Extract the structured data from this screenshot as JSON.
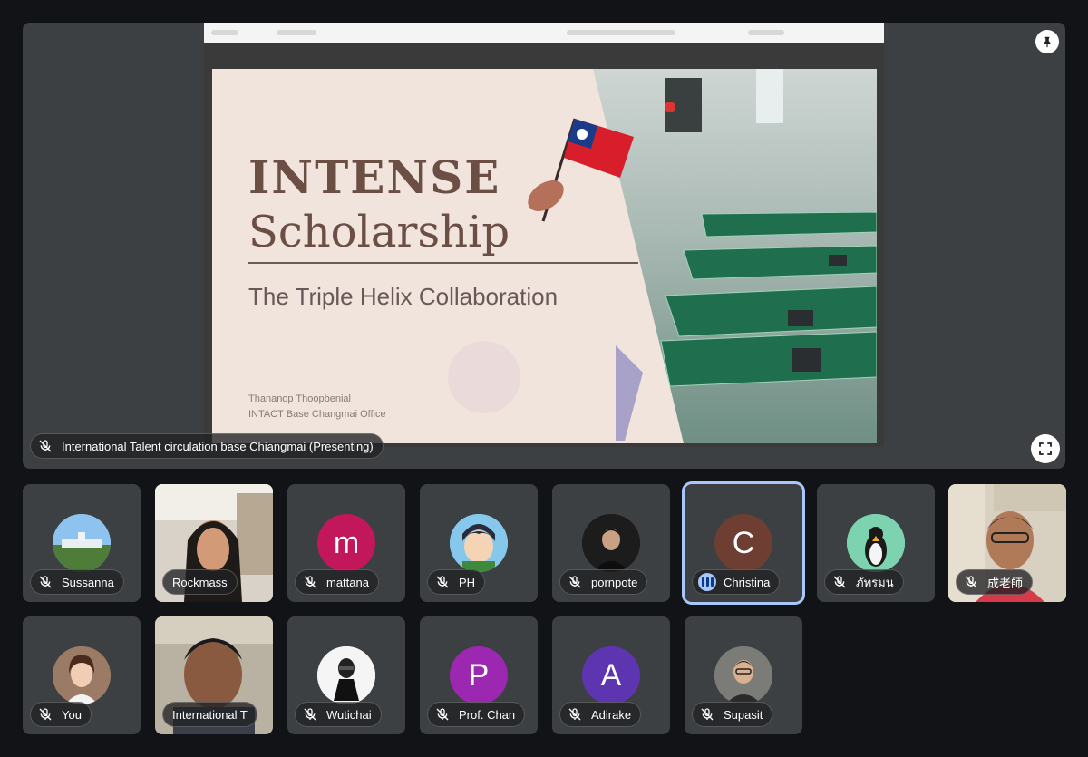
{
  "slide": {
    "title_line1": "INTENSE",
    "title_line2": "Scholarship",
    "subtitle": "The Triple Helix Collaboration",
    "presenter_name": "Thananop Thoopbenial",
    "presenter_office": "INTACT Base Changmai Office"
  },
  "presenter_badge": "International Talent circulation base Chiangmai (Presenting)",
  "icons": {
    "pin": "pin-icon",
    "fullscreen": "fullscreen-icon",
    "mic_off": "mic-off-icon",
    "speaking": "audio-level-icon"
  },
  "colors": {
    "background": "#121316",
    "tile": "#3c4043",
    "active_border": "#a8c7fa",
    "speaking_badge": "#a8c7fa"
  },
  "participants": [
    {
      "name": "Sussanna"
    },
    {
      "name": "Rockmass"
    },
    {
      "name": "mattana",
      "initial": "m",
      "color": "#c2185b"
    },
    {
      "name": "PH"
    },
    {
      "name": "pornpote"
    },
    {
      "name": "Christina",
      "initial": "C",
      "color": "#6d3e31"
    },
    {
      "name": "ภัทรมน"
    },
    {
      "name": "成老師"
    },
    {
      "name": "You"
    },
    {
      "name": "International T"
    },
    {
      "name": "Wutichai"
    },
    {
      "name": "Prof. Chan",
      "initial": "P",
      "color": "#9c27b0"
    },
    {
      "name": "Adirake",
      "initial": "A",
      "color": "#5e35b1"
    },
    {
      "name": "Supasit"
    }
  ]
}
